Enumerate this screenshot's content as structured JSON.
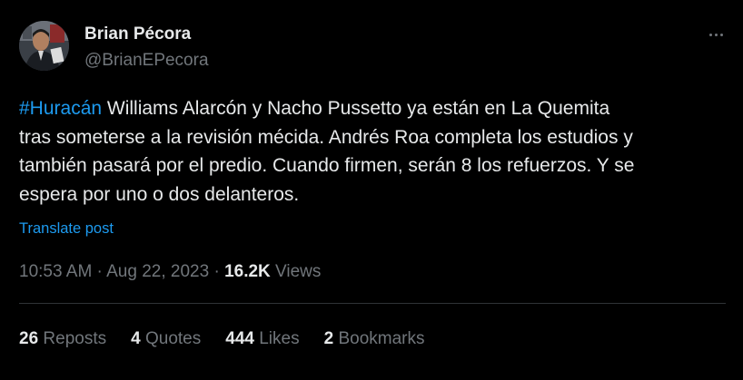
{
  "author": {
    "name": "Brian Pécora",
    "handle": "@BrianEPecora"
  },
  "tweet": {
    "hashtag": "#Huracán",
    "line1_rest": " Williams Alarcón y Nacho Pussetto ya están en La Quemita",
    "line2": "tras someterse a la revisión mécida. Andrés Roa completa los estudios y",
    "line3": "también pasará por el predio. Cuando firmen, serán 8 los refuerzos. Y se",
    "line4": "espera por uno o dos delanteros.",
    "translate_label": "Translate post"
  },
  "meta": {
    "time": "10:53 AM",
    "separator": " · ",
    "date": "Aug 22, 2023",
    "views_count": "16.2K",
    "views_label": " Views"
  },
  "stats": {
    "reposts": {
      "count": "26",
      "label": " Reposts"
    },
    "quotes": {
      "count": "4",
      "label": " Quotes"
    },
    "likes": {
      "count": "444",
      "label": " Likes"
    },
    "bookmarks": {
      "count": "2",
      "label": " Bookmarks"
    }
  },
  "icons": {
    "more": "more-options-icon"
  },
  "colors": {
    "background": "#000000",
    "text": "#e7e9ea",
    "secondary": "#71767b",
    "accent": "#1d9bf0",
    "divider": "#2f3336"
  }
}
